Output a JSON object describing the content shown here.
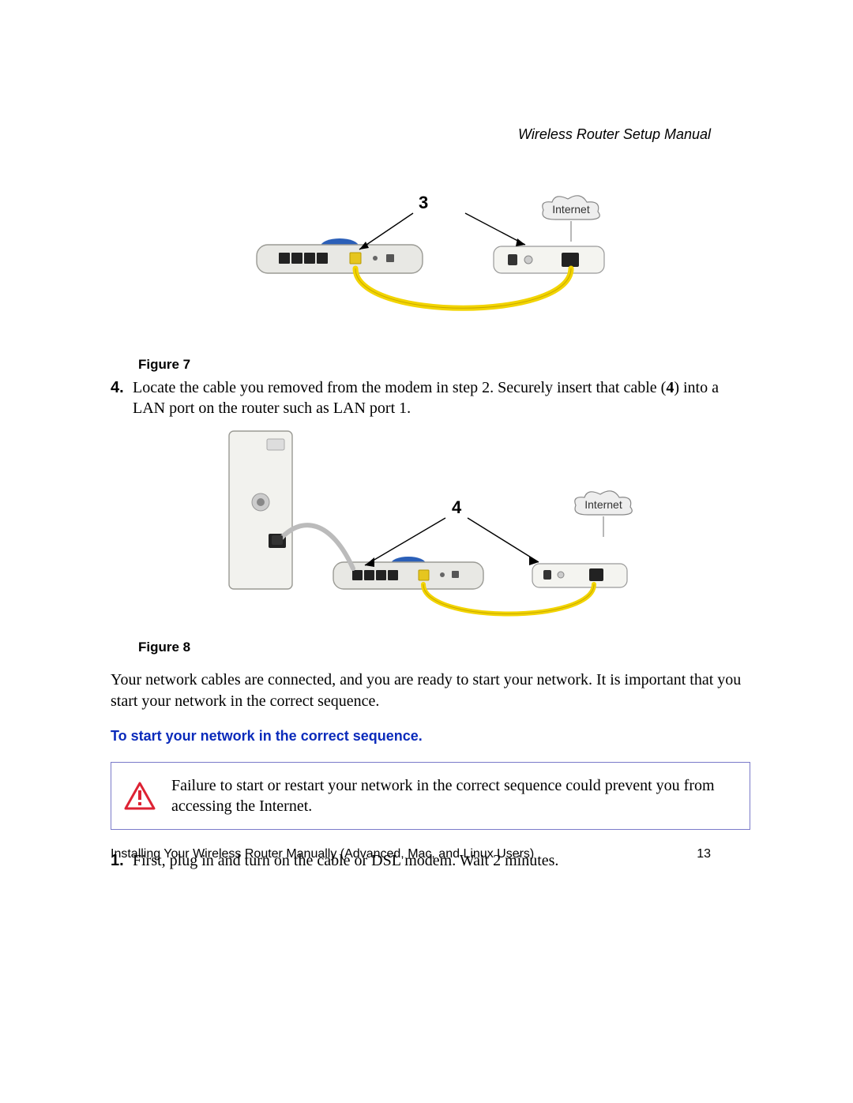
{
  "header": {
    "title": "Wireless Router Setup Manual"
  },
  "figure7": {
    "caption": "Figure 7",
    "callout": "3",
    "internet_label": "Internet"
  },
  "step4": {
    "num": "4.",
    "text_before_bold": "Locate the cable you removed from the modem in step 2. Securely insert that cable (",
    "bold": "4",
    "text_after_bold": ") into a LAN port on the router such as LAN port 1."
  },
  "figure8": {
    "caption": "Figure 8",
    "callout": "4",
    "internet_label": "Internet"
  },
  "body_para": "Your network cables are connected, and you are ready to start your network. It is important that you start your network in the correct sequence.",
  "subhead": "To start your network in the correct sequence.",
  "warning": {
    "text": "Failure to start or restart your network in the correct sequence could prevent you from accessing the Internet."
  },
  "step1": {
    "num": "1.",
    "text": "First, plug in and turn on the cable or DSL modem. Wait 2 minutes."
  },
  "footer": {
    "left": "Installing Your Wireless Router Manually (Advanced, Mac, and Linux Users)",
    "right": "13"
  }
}
